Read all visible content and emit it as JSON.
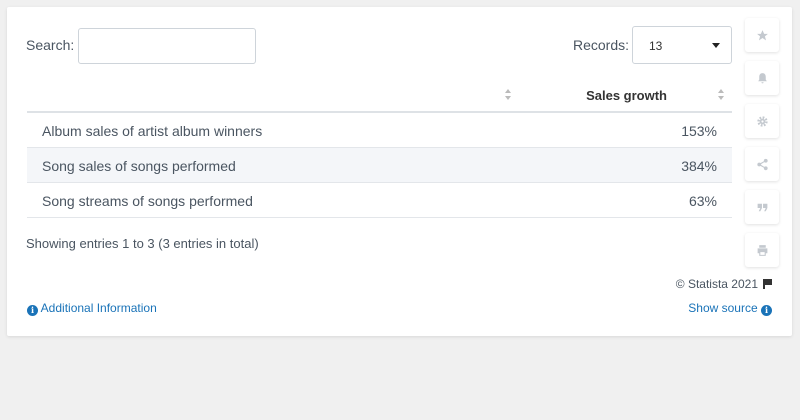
{
  "search": {
    "label": "Search:",
    "value": "",
    "placeholder": ""
  },
  "records": {
    "label": "Records:",
    "selected": "13"
  },
  "table": {
    "headers": {
      "name": "",
      "sales": "Sales growth"
    },
    "rows": [
      {
        "name": "Album sales of artist album winners",
        "value": "153%"
      },
      {
        "name": "Song sales of songs performed",
        "value": "384%"
      },
      {
        "name": "Song streams of songs performed",
        "value": "63%"
      }
    ]
  },
  "footer": {
    "showing": "Showing entries 1 to 3 (3 entries in total)",
    "copyright": "© Statista 2021",
    "additional_info": "Additional Information",
    "show_source": "Show source"
  },
  "sidebar": {
    "icons": [
      "star-icon",
      "bell-icon",
      "gear-icon",
      "share-icon",
      "quote-icon",
      "print-icon"
    ]
  },
  "colors": {
    "link": "#1a73b8",
    "icon": "#c4c9cf",
    "row_alt": "#f4f6f9"
  }
}
